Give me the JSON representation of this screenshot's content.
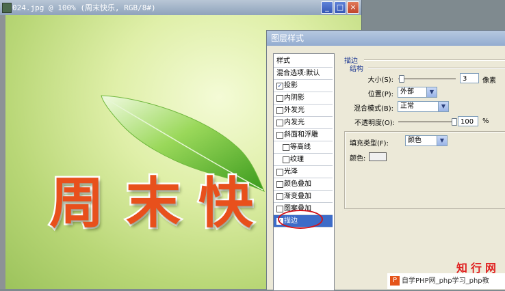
{
  "document": {
    "title": "024.jpg @ 100% (周末快乐, RGB/8#)",
    "window_buttons": [
      "_",
      "□",
      "×"
    ],
    "artwork_text": [
      "周",
      "末",
      "快"
    ]
  },
  "dialog": {
    "title": "图层样式",
    "style_list": {
      "header": "样式",
      "blend_options": "混合选项:默认",
      "items": [
        {
          "label": "投影",
          "checked": true,
          "indent": false
        },
        {
          "label": "内阴影",
          "checked": false,
          "indent": false
        },
        {
          "label": "外发光",
          "checked": false,
          "indent": false
        },
        {
          "label": "内发光",
          "checked": false,
          "indent": false
        },
        {
          "label": "斜面和浮雕",
          "checked": false,
          "indent": false
        },
        {
          "label": "等高线",
          "checked": false,
          "indent": true
        },
        {
          "label": "纹理",
          "checked": false,
          "indent": true
        },
        {
          "label": "光泽",
          "checked": false,
          "indent": false
        },
        {
          "label": "颜色叠加",
          "checked": false,
          "indent": false
        },
        {
          "label": "渐变叠加",
          "checked": false,
          "indent": false
        },
        {
          "label": "图案叠加",
          "checked": false,
          "indent": false
        },
        {
          "label": "描边",
          "checked": true,
          "indent": false,
          "selected": true
        }
      ]
    },
    "stroke": {
      "section_title": "描边",
      "structure_title": "结构",
      "size_label": "大小(S):",
      "size_value": "3",
      "size_unit": "像素",
      "position_label": "位置(P):",
      "position_value": "外部",
      "blend_mode_label": "混合模式(B):",
      "blend_mode_value": "正常",
      "opacity_label": "不透明度(O):",
      "opacity_value": "100",
      "opacity_unit": "%",
      "fill_type_label": "填充类型(F):",
      "fill_type_value": "颜色",
      "color_label": "颜色:",
      "color_value": "#f0f0f0"
    }
  },
  "watermark": {
    "site_name": "知行网",
    "bottom_logo": "P",
    "bottom_text": "自学PHP网_php学习_php教"
  },
  "colors": {
    "text_fill": "#e8501c",
    "selection": "#3d6cc8",
    "highlight": "#d1131b"
  }
}
